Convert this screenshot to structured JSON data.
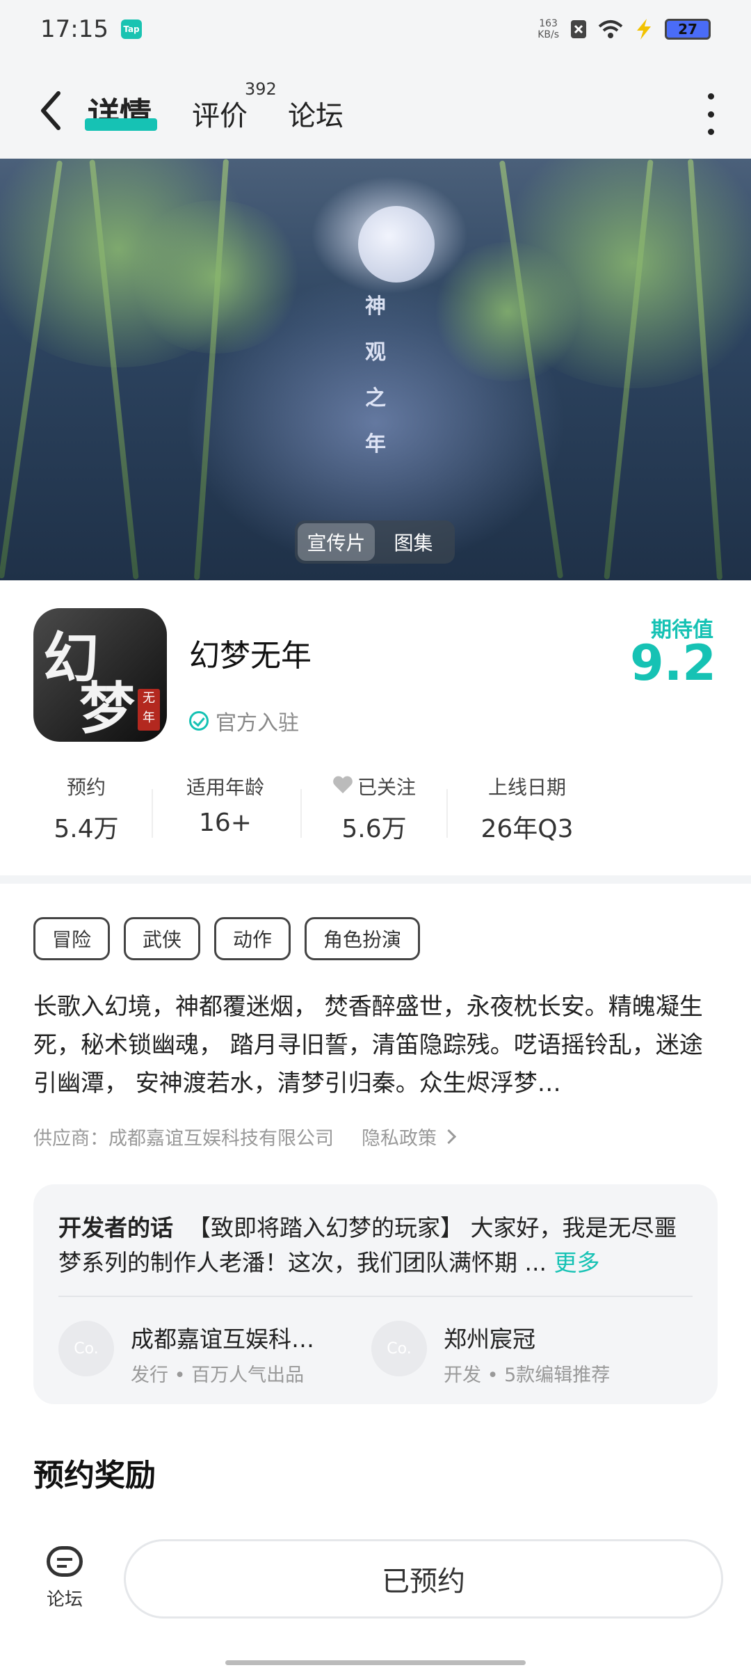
{
  "status": {
    "time": "17:15",
    "tap_badge": "Tap",
    "speed_value": "163",
    "speed_unit": "KB/s",
    "battery": "27"
  },
  "header": {
    "tab_detail": "详情",
    "tab_review": "评价",
    "review_count": "392",
    "tab_forum": "论坛"
  },
  "hero": {
    "title_chars": [
      "神",
      "观",
      "之",
      "年"
    ],
    "media_tabs": [
      "宣传片",
      "图集"
    ],
    "active_media": "宣传片"
  },
  "app": {
    "name": "幻梦无年",
    "icon_text": [
      "幻",
      "梦"
    ],
    "icon_seal": "无年",
    "official_label": "官方入驻",
    "expect_label": "期待值",
    "expect_value": "9.2"
  },
  "stats": [
    {
      "label": "预约",
      "value": "5.4万"
    },
    {
      "label": "适用年龄",
      "value": "16+"
    },
    {
      "label": "已关注",
      "value": "5.6万"
    },
    {
      "label": "上线日期",
      "value": "26年Q3"
    }
  ],
  "tags": [
    "冒险",
    "武侠",
    "动作",
    "角色扮演"
  ],
  "description": "长歌入幻境，神都覆迷烟， 焚香醉盛世，永夜枕长安。精魄凝生死，秘术锁幽魂， 踏月寻旧誓，清笛隐踪残。呓语摇铃乱，迷途引幽潭， 安神渡若水，清梦引归秦。众生烬浮梦…",
  "supplier": {
    "label": "供应商：成都嘉谊互娱科技有限公司",
    "privacy": "隐私政策"
  },
  "developer": {
    "heading": "开发者的话",
    "text": "【致即将踏入幻梦的玩家】 大家好，我是无尽噩梦系列的制作人老潘！这次，我们团队满怀期 ...",
    "more": "更多",
    "companies": [
      {
        "avatar": "Co.",
        "name": "成都嘉谊互娱科…",
        "sub": "发行 • 百万人气出品"
      },
      {
        "avatar": "Co.",
        "name": "郑州宸冠",
        "sub": "开发 • 5款编辑推荐"
      }
    ]
  },
  "reward_title": "预约奖励",
  "bottom": {
    "forum_label": "论坛",
    "reserve_label": "已预约"
  },
  "colors": {
    "accent": "#16c2b4"
  }
}
